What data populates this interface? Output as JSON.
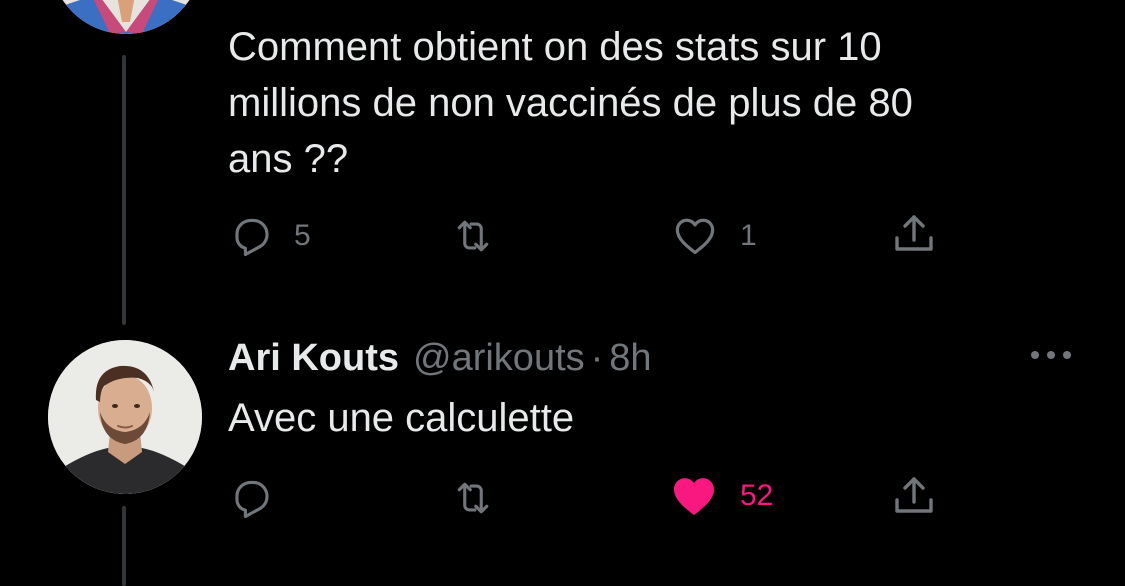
{
  "parent_tweet": {
    "text": "Comment obtient on des stats sur 10\nmillions de non vaccinés de plus de 80\nans ??",
    "actions": {
      "reply_count": "5",
      "retweet_count": "",
      "like_count": "1"
    }
  },
  "reply_tweet": {
    "display_name": "Ari Kouts",
    "handle": "@arikouts",
    "separator": "·",
    "time": "8h",
    "text": "Avec une calculette",
    "actions": {
      "reply_count": "",
      "retweet_count": "",
      "like_count": "52",
      "liked": true
    }
  },
  "icons": {
    "reply": "speech-bubble-icon",
    "retweet": "retweet-arrows-icon",
    "like": "heart-icon",
    "share": "share-upload-icon",
    "more": "three-dots-icon"
  },
  "colors": {
    "background": "#000000",
    "text": "#e7e9ea",
    "secondary": "#71767b",
    "like_active": "#f91880",
    "thread_line": "#333639"
  }
}
